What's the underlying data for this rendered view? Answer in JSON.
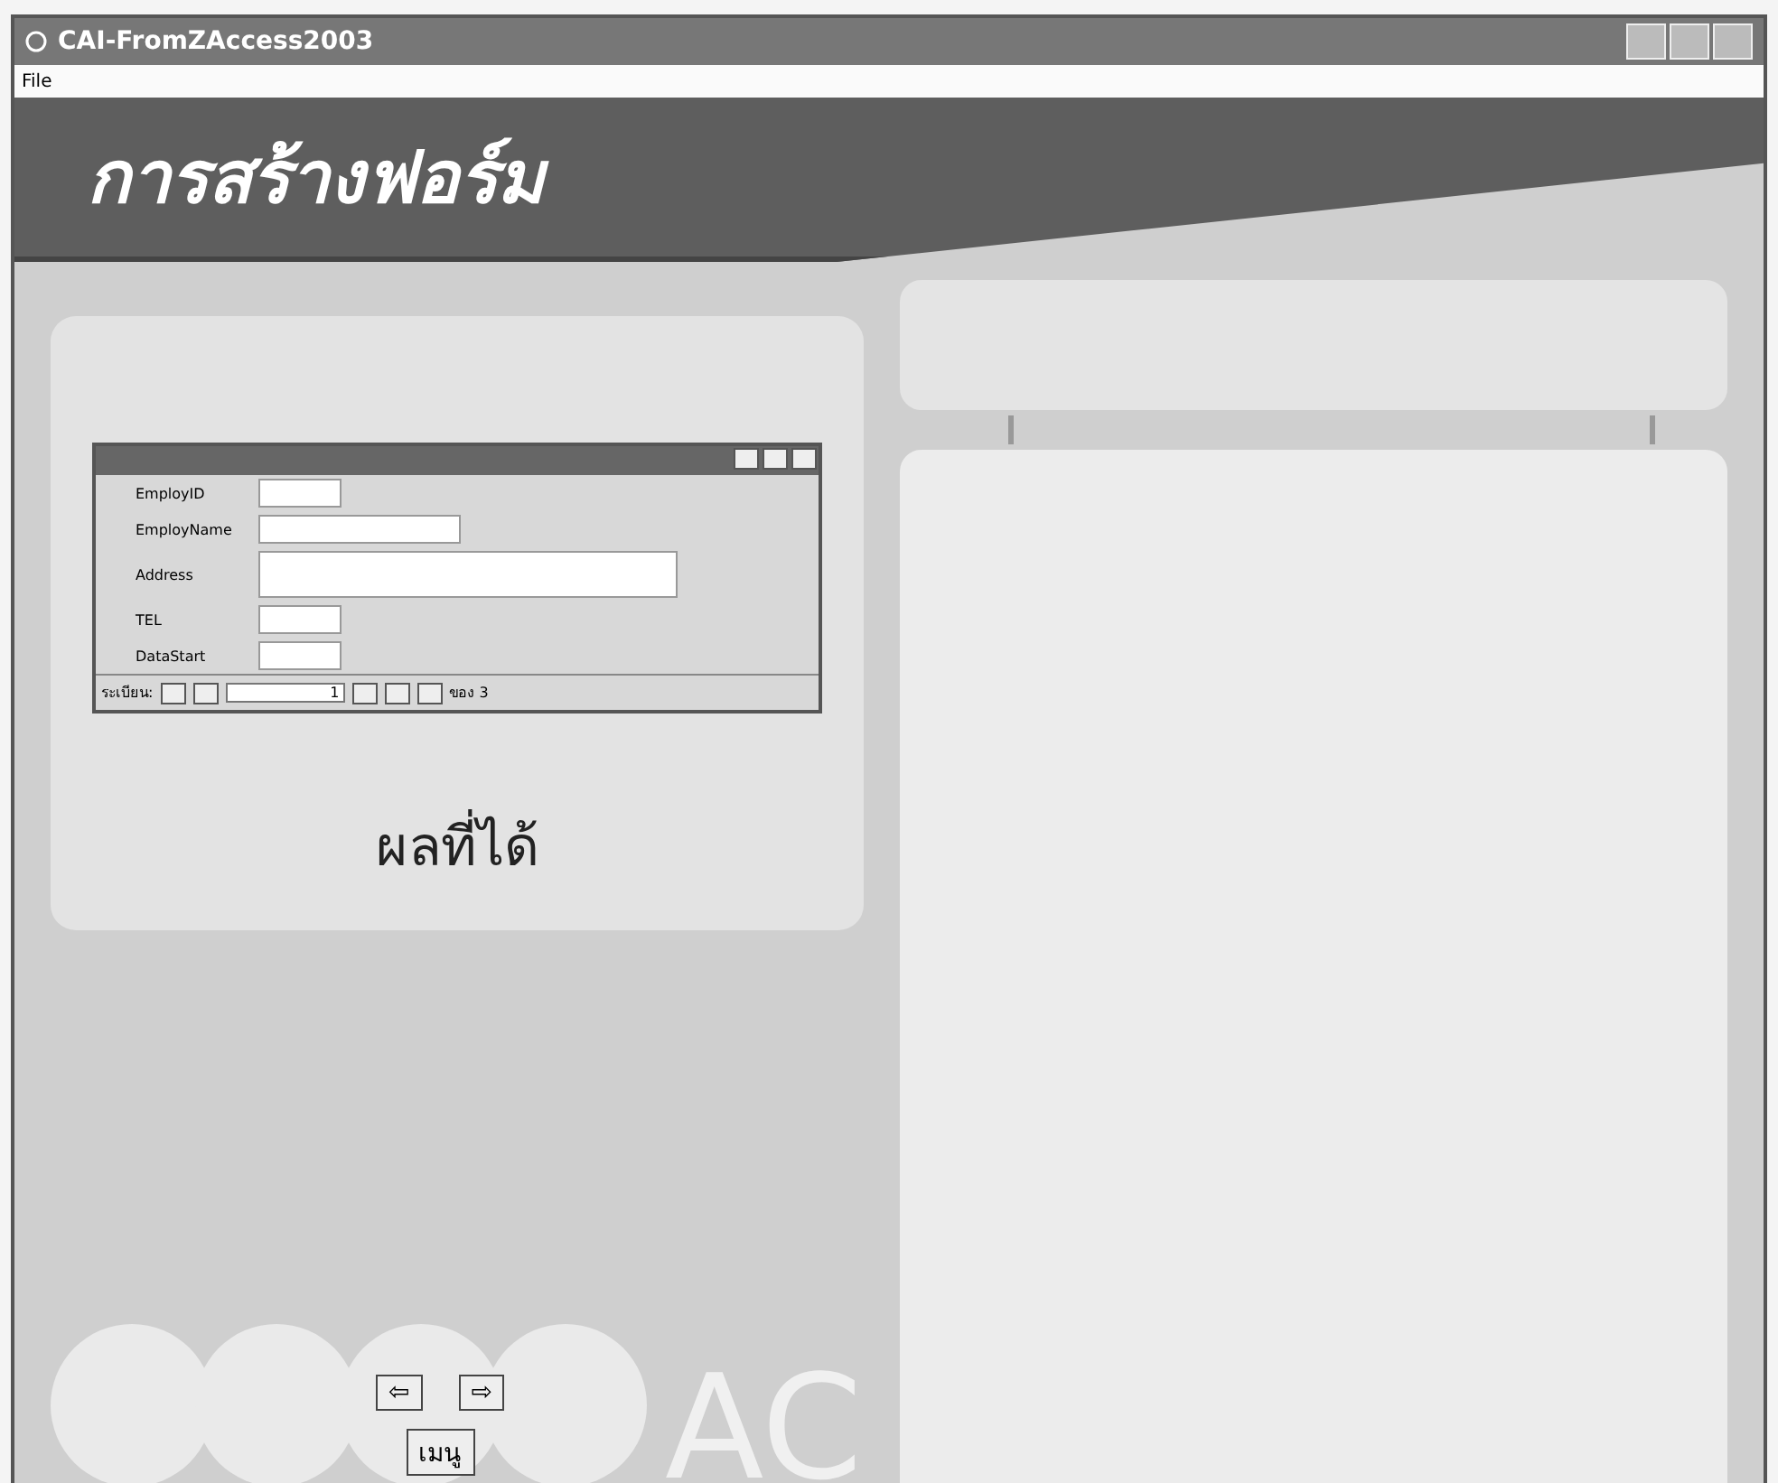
{
  "window": {
    "title": "CAI-FromZAccess2003"
  },
  "menu": [
    "File"
  ],
  "banner": {
    "title": "การสร้างฟอร์ม"
  },
  "form_window": {
    "fields": [
      {
        "label": "EmployID",
        "kind": "short"
      },
      {
        "label": "EmployName",
        "kind": "medium"
      },
      {
        "label": "Address",
        "kind": "long"
      },
      {
        "label": "TEL",
        "kind": "short"
      },
      {
        "label": "DataStart",
        "kind": "short"
      }
    ],
    "navigator": {
      "label": "ระเบียน:",
      "record": "1",
      "total": "ของ 3"
    }
  },
  "result_caption": "ผลที่ได้",
  "watermark": "AC",
  "nav_buttons": {
    "back": "⇦",
    "next": "⇨",
    "menu": "เมนู"
  }
}
